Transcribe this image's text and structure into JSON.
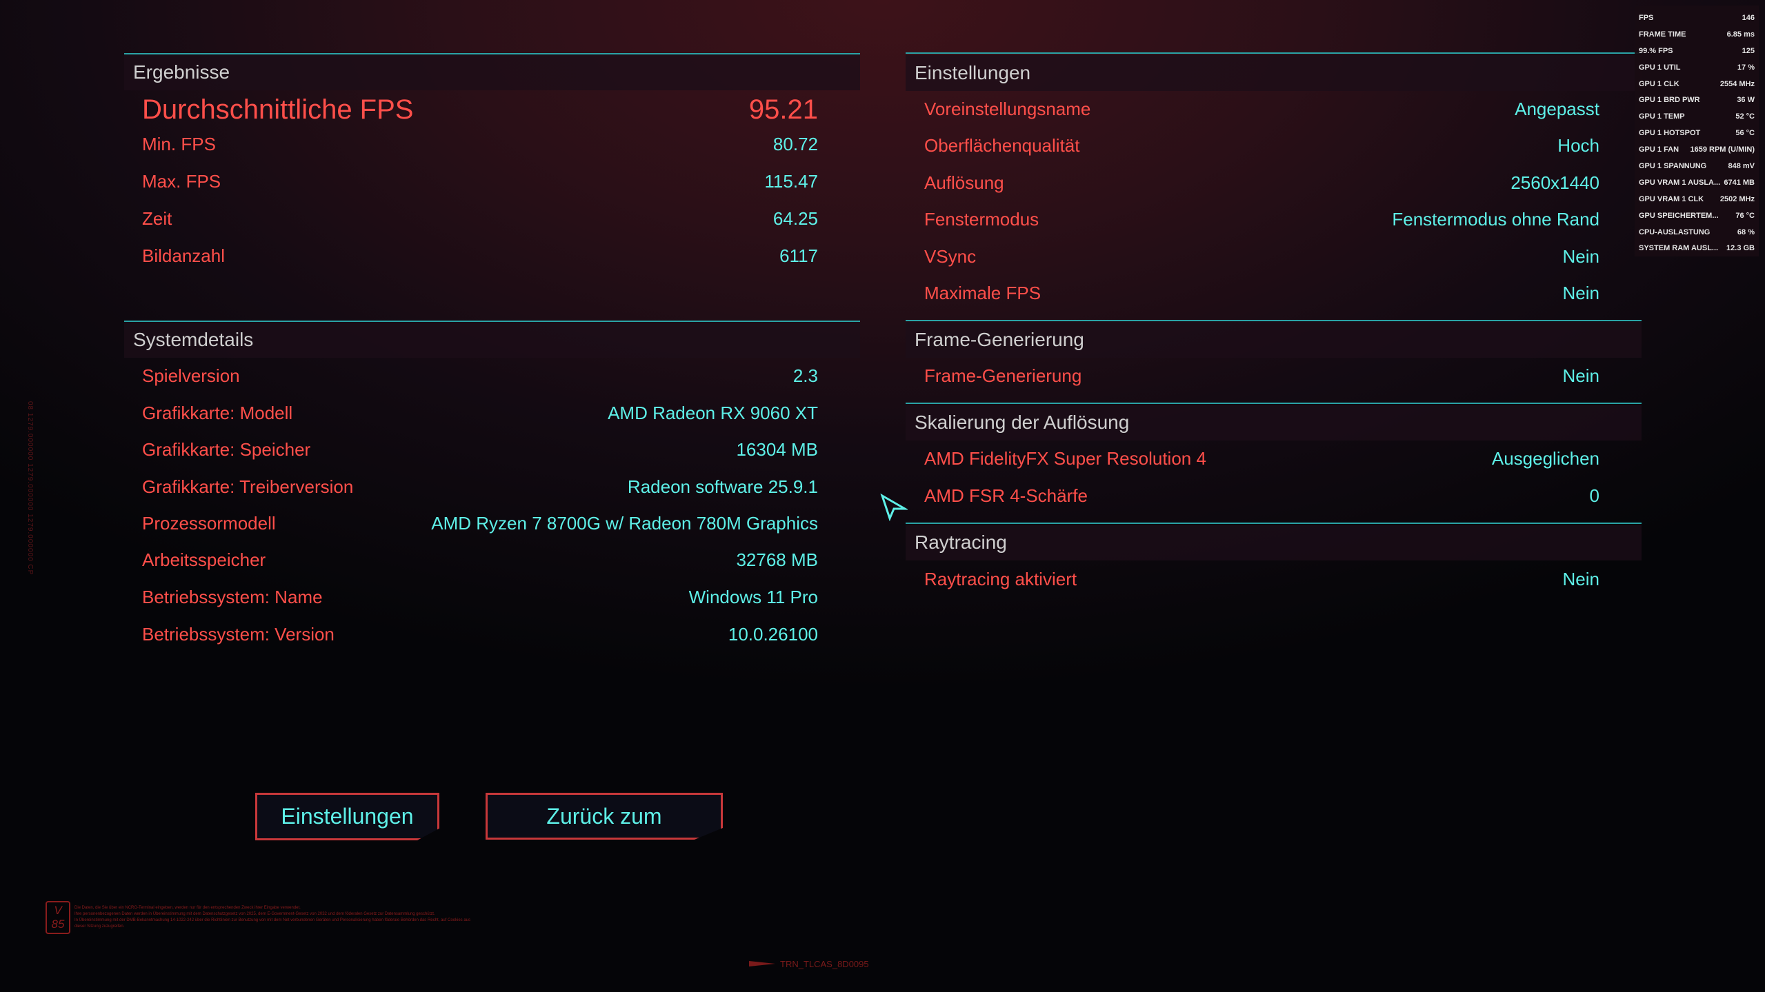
{
  "results": {
    "title": "Ergebnisse",
    "avg_label": "Durchschnittliche FPS",
    "avg_value": "95.21",
    "rows": [
      {
        "label": "Min. FPS",
        "value": "80.72"
      },
      {
        "label": "Max. FPS",
        "value": "115.47"
      },
      {
        "label": "Zeit",
        "value": "64.25"
      },
      {
        "label": "Bildanzahl",
        "value": "6117"
      }
    ]
  },
  "system": {
    "title": "Systemdetails",
    "rows": [
      {
        "label": "Spielversion",
        "value": "2.3"
      },
      {
        "label": "Grafikkarte: Modell",
        "value": "AMD Radeon RX 9060 XT"
      },
      {
        "label": "Grafikkarte: Speicher",
        "value": "16304 MB"
      },
      {
        "label": "Grafikkarte: Treiberversion",
        "value": "Radeon software 25.9.1"
      },
      {
        "label": "Prozessormodell",
        "value": "AMD Ryzen 7 8700G w/ Radeon 780M Graphics"
      },
      {
        "label": "Arbeitsspeicher",
        "value": "32768 MB"
      },
      {
        "label": "Betriebssystem: Name",
        "value": "Windows 11 Pro"
      },
      {
        "label": "Betriebssystem: Version",
        "value": "10.0.26100"
      }
    ]
  },
  "settings": {
    "title": "Einstellungen",
    "rows": [
      {
        "label": "Voreinstellungsname",
        "value": "Angepasst"
      },
      {
        "label": "Oberflächenqualität",
        "value": "Hoch"
      },
      {
        "label": "Auflösung",
        "value": "2560x1440"
      },
      {
        "label": "Fenstermodus",
        "value": "Fenstermodus ohne Rand"
      },
      {
        "label": "VSync",
        "value": "Nein"
      },
      {
        "label": "Maximale FPS",
        "value": "Nein"
      }
    ]
  },
  "framegen": {
    "title": "Frame-Generierung",
    "rows": [
      {
        "label": "Frame-Generierung",
        "value": "Nein"
      }
    ]
  },
  "scaling": {
    "title": "Skalierung der Auflösung",
    "rows": [
      {
        "label": "AMD FidelityFX Super Resolution 4",
        "value": "Ausgeglichen"
      },
      {
        "label": "AMD FSR 4-Schärfe",
        "value": "0"
      }
    ]
  },
  "raytracing": {
    "title": "Raytracing",
    "rows": [
      {
        "label": "Raytracing aktiviert",
        "value": "Nein"
      }
    ]
  },
  "buttons": {
    "settings": "Einstellungen",
    "back": "Zurück zum Hauptmenü"
  },
  "osd": [
    {
      "k": "FPS",
      "v": "146"
    },
    {
      "k": "FRAME TIME",
      "v": "6.85 ms"
    },
    {
      "k": "99.% FPS",
      "v": "125"
    },
    {
      "k": "GPU 1 UTIL",
      "v": "17 %"
    },
    {
      "k": "GPU 1 CLK",
      "v": "2554 MHz"
    },
    {
      "k": "GPU 1 BRD PWR",
      "v": "36 W"
    },
    {
      "k": "GPU 1 TEMP",
      "v": "52 °C"
    },
    {
      "k": "GPU 1 HOTSPOT",
      "v": "56 °C"
    },
    {
      "k": "GPU 1 FAN",
      "v": "1659 RPM (U/MIN)"
    },
    {
      "k": "GPU 1 SPANNUNG",
      "v": "848 mV"
    },
    {
      "k": "GPU VRAM 1 AUSLA...",
      "v": "6741 MB"
    },
    {
      "k": "GPU VRAM 1 CLK",
      "v": "2502 MHz"
    },
    {
      "k": "GPU SPEICHERTEM...",
      "v": "76 °C"
    },
    {
      "k": "CPU-AUSLASTUNG",
      "v": "68 %"
    },
    {
      "k": "SYSTEM RAM AUSL...",
      "v": "12.3 GB"
    }
  ],
  "footer": {
    "badge": "V 85",
    "legal": [
      "Die Daten, die Sie über ein NCRO-Terminal eingeben, werden nur für den entsprechenden Zweck ihrer Eingabe verwendet.",
      "Ihre personenbezogenen Daten werden in Übereinstimmung mit dem Datenschutzgesetz von 2025, dem E-Government-Gesetz von 2032 und dem föderalen Gesetz zur Datensammlung geschützt.",
      "In Übereinstimmung mit der DMB-Bekanntmachung 14-1022-242 über die Richtlinien zur Benutzung von mit dem Net verbundenen Geräten und Personalisierung haben föderale Behörden das Recht, auf Cookies aus",
      "dieser Sitzung zuzugreifen."
    ],
    "code": "TRN_TLCAS_8D0095",
    "vertical": "08 1279.000000 1279.000000 1279.000000 CP"
  }
}
